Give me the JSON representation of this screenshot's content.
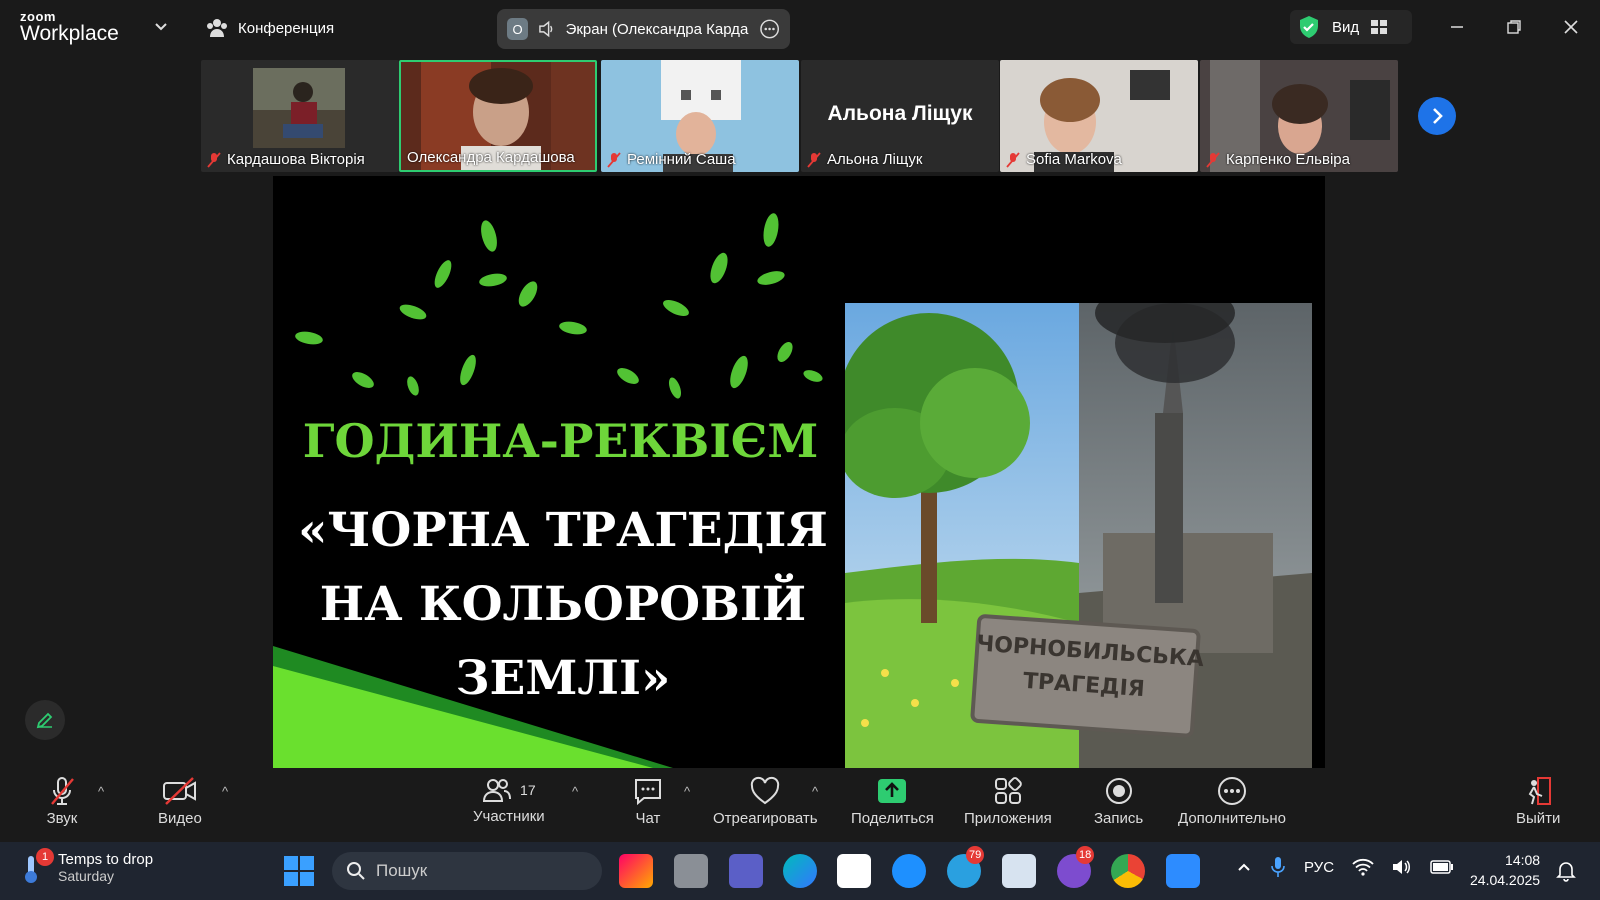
{
  "topbar": {
    "logo_small": "zoom",
    "logo_big": "Workplace",
    "conference_label": "Конференция",
    "screen_badge": "O",
    "screen_label": "Экран (Олександра Кардаш",
    "view_label": "Вид",
    "shield_color": "#2ecc71"
  },
  "participants": [
    {
      "name": "Кардашова Вікторія",
      "muted": true
    },
    {
      "name": "Олександра Кардашова",
      "muted": false,
      "active": true
    },
    {
      "name": "Ремінний Саша",
      "muted": true
    },
    {
      "name": "Альона Ліщук",
      "muted": true,
      "display_name": "Альона Ліщук"
    },
    {
      "name": "Sofia Markova",
      "muted": true
    },
    {
      "name": "Карпенко Ельвіра",
      "muted": true
    }
  ],
  "slide": {
    "title_line1": "ГОДИНА-РЕКВІЄМ",
    "title_line2": "«ЧОРНА ТРАГЕДІЯ НА КОЛЬОРОВІЙ ЗЕМЛІ»",
    "sign_line1": "ЧОРНОБИЛЬСЬКА",
    "sign_line2": "ТРАГЕДІЯ",
    "accent_color": "#6ed63a"
  },
  "toolbar": {
    "audio": "Звук",
    "video": "Видео",
    "participants": "Участники",
    "participants_count": "17",
    "chat": "Чат",
    "react": "Отреагировать",
    "share": "Поделиться",
    "apps": "Приложения",
    "record": "Запись",
    "more": "Дополнительно",
    "leave": "Выйти",
    "share_color": "#2ecc71"
  },
  "taskbar": {
    "weather_title": "Temps to drop",
    "weather_sub": "Saturday",
    "weather_badge": "1",
    "search_placeholder": "Пошук",
    "telegram_badge": "79",
    "viber_badge": "18",
    "lang": "РУС",
    "time": "14:08",
    "date": "24.04.2025"
  }
}
